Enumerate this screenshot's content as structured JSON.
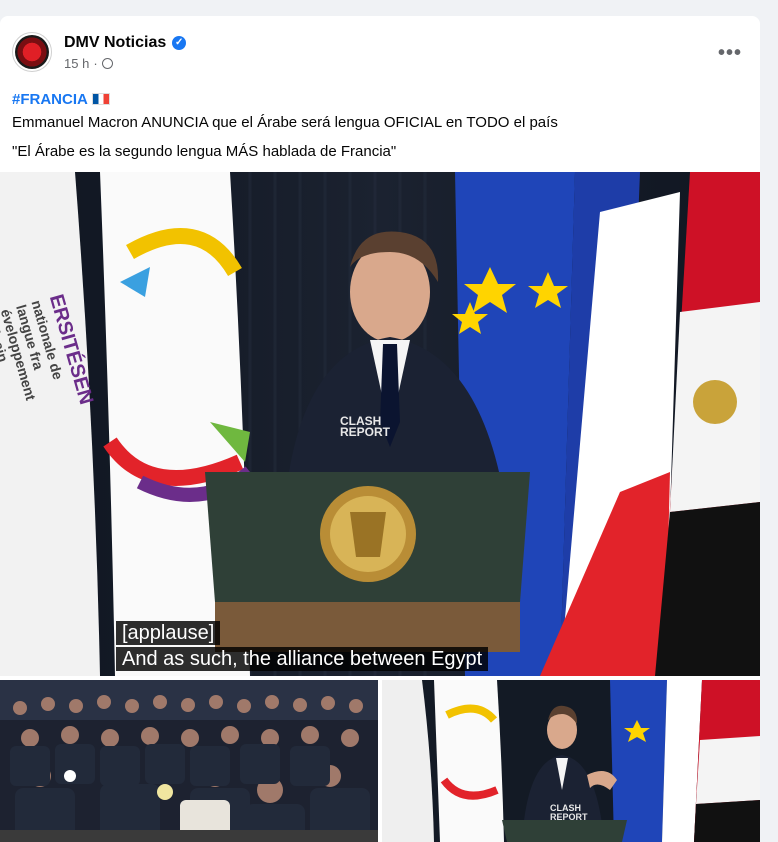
{
  "post": {
    "page_name": "DMV Noticias",
    "time": "15 h",
    "dot": "·",
    "more_label": "•••",
    "hashtag": "#FRANCIA",
    "line1": "Emmanuel Macron ANUNCIA que el Árabe será lengua OFICIAL en TODO el país",
    "line2": "\"El Árabe es la segundo lengua MÁS hablada de Francia\""
  },
  "video": {
    "caption_line1": "[applause]",
    "caption_line2": "And as such, the alliance between Egypt",
    "watermark_top": "CLASH",
    "watermark_bottom": "REPORT",
    "banner_text_1": "ERSITÉSEN",
    "banner_text_2": "nationale de langue fra",
    "banner_text_3": "éveloppement africain"
  },
  "icons": {
    "verified": "verified-badge-icon",
    "audience": "globe-icon",
    "more": "more-options-icon"
  },
  "colors": {
    "link": "#1877f2",
    "text": "#050505",
    "muted": "#65676b",
    "background": "#f0f2f5"
  }
}
